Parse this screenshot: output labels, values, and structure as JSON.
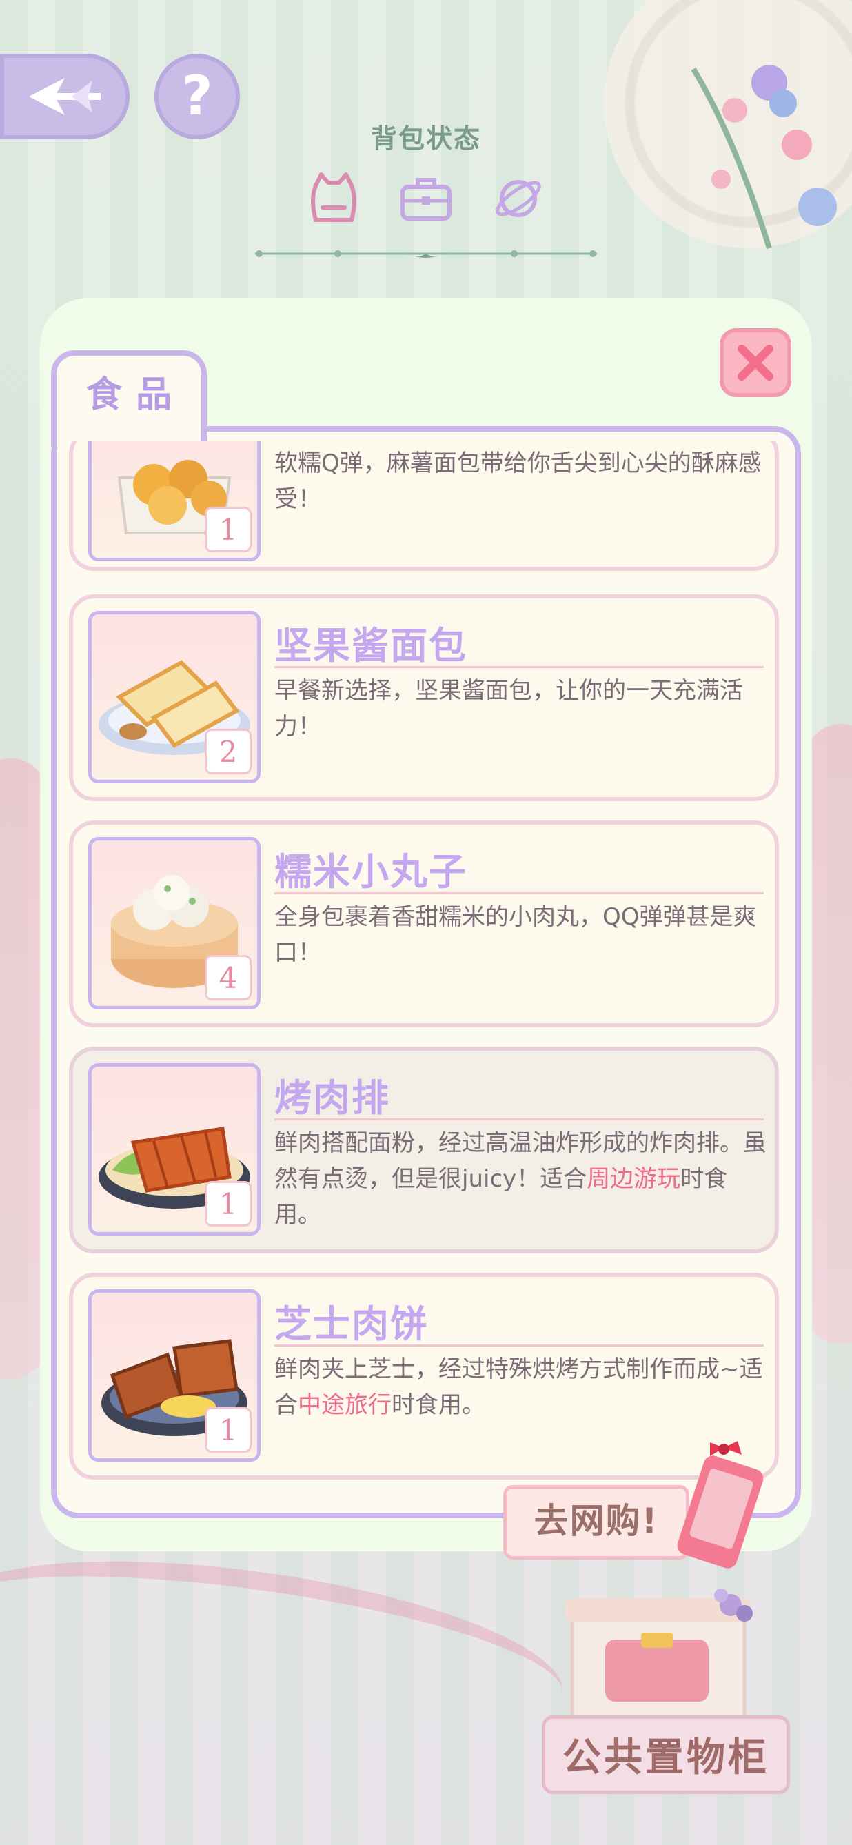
{
  "header": {
    "title": "背包状态",
    "tabs": [
      {
        "icon": "cat-backpack-icon",
        "active": true
      },
      {
        "icon": "suitcase-icon",
        "active": false
      },
      {
        "icon": "planet-icon",
        "active": false
      }
    ]
  },
  "panel": {
    "tab_label": "食品",
    "items": [
      {
        "name": "",
        "desc_parts": [
          "软糯Q弹，麻薯面包带给你舌尖到心尖的酥麻感受！"
        ],
        "highlights": [],
        "qty": "1",
        "image": "mochi-bread-basket"
      },
      {
        "name": "坚果酱面包",
        "desc_parts": [
          "早餐新选择，坚果酱面包，让你的一天充满活力！"
        ],
        "highlights": [],
        "qty": "2",
        "image": "nut-butter-toast"
      },
      {
        "name": "糯米小丸子",
        "desc_parts": [
          "全身包裹着香甜糯米的小肉丸，QQ弹弹甚是爽口！"
        ],
        "highlights": [],
        "qty": "4",
        "image": "glutinous-rice-balls"
      },
      {
        "name": "烤肉排",
        "desc_parts": [
          "鲜肉搭配面粉，经过高温油炸形成的炸肉排。虽然有点烫，但是很juicy！适合",
          "时食用。"
        ],
        "highlights": [
          "周边游玩"
        ],
        "qty": "1",
        "image": "fried-pork-cutlet",
        "selected": true
      },
      {
        "name": "芝士肉饼",
        "desc_parts": [
          "鲜肉夹上芝士，经过特殊烘烤方式制作而成~适合",
          "时食用。"
        ],
        "highlights": [
          "中途旅行"
        ],
        "qty": "1",
        "image": "cheese-meat-patty"
      }
    ]
  },
  "buttons": {
    "shop": "去网购!",
    "locker": "公共置物柜"
  },
  "colors": {
    "accent_purple": "#c5a7ef",
    "accent_pink": "#ef6b8d",
    "panel_bg": "#f1fbe9"
  }
}
